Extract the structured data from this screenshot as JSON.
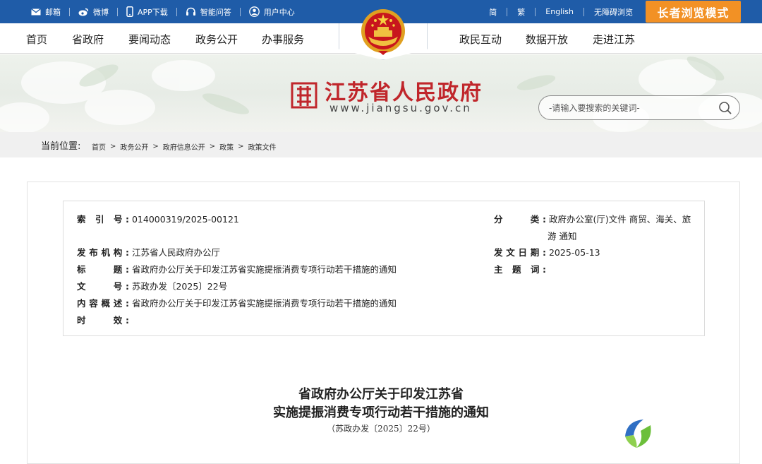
{
  "topbar": {
    "links": [
      {
        "icon": "mail-icon",
        "label": "邮箱"
      },
      {
        "icon": "weibo-icon",
        "label": "微博"
      },
      {
        "icon": "phone-icon",
        "label": "APP下载"
      },
      {
        "icon": "headset-icon",
        "label": "智能问答"
      },
      {
        "icon": "user-icon",
        "label": "用户中心"
      }
    ],
    "simplified": "简",
    "traditional": "繁",
    "english": "English",
    "accessible": "无障碍浏览",
    "elder_mode": "长者浏览模式"
  },
  "nav": {
    "items_left": [
      "首页",
      "省政府",
      "要闻动态",
      "政务公开",
      "办事服务"
    ],
    "items_right": [
      "政民互动",
      "数据开放",
      "走进江苏"
    ]
  },
  "banner": {
    "title": "江苏省人民政府",
    "url": "www.jiangsu.gov.cn",
    "search_placeholder": "-请输入要搜索的关键词-"
  },
  "breadcrumb": {
    "label": "当前位置:",
    "items": [
      "首页",
      "政务公开",
      "政府信息公开",
      "政策",
      "政策文件"
    ]
  },
  "meta": {
    "index_key": "索 引 号:",
    "index_val": "014000319/2025-00121",
    "category_key": "分　　类:",
    "category_val_1": "政府办公室(厅)文件 商贸、海关、旅",
    "category_val_2": "游 通知",
    "publisher_key": "发布机构:",
    "publisher_val": "江苏省人民政府办公厅",
    "date_key": "发文日期:",
    "date_val": "2025-05-13",
    "title_key": "标　　题:",
    "title_val": "省政府办公厅关于印发江苏省实施提振消费专项行动若干措施的通知",
    "subject_key": "主 题 词:",
    "subject_val": "",
    "docno_key": "文　　号:",
    "docno_val": "苏政办发〔2025〕22号",
    "summary_key": "内容概述:",
    "summary_val": "省政府办公厅关于印发江苏省实施提振消费专项行动若干措施的通知",
    "validity_key": "时　　效:",
    "validity_val": ""
  },
  "document": {
    "title_line1": "省政府办公厅关于印发江苏省",
    "title_line2": "实施提振消费专项行动若干措施的通知",
    "number": "（苏政办发〔2025〕22号）"
  },
  "colors": {
    "topbar": "#1f5ca8",
    "elder_button": "#f29125",
    "title_red": "#c0262b"
  }
}
